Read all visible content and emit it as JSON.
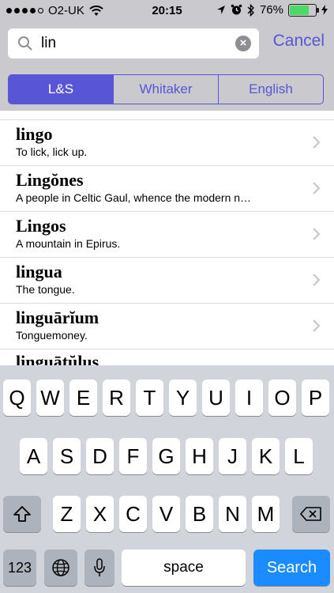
{
  "status_bar": {
    "carrier": "O2-UK",
    "time": "20:15",
    "battery": "76%",
    "battery_level": 0.76,
    "signal_bars_filled": 4,
    "signal_bars_total": 5
  },
  "search": {
    "value": "lin",
    "cancel_label": "Cancel"
  },
  "segments": [
    {
      "label": "L&S",
      "active": true
    },
    {
      "label": "Whitaker",
      "active": false
    },
    {
      "label": "English",
      "active": false
    }
  ],
  "results": [
    {
      "headword": "lingo",
      "definition": "To lick, lick up."
    },
    {
      "headword": "Lingŏnes",
      "definition": "A people in Celtic Gaul, whence the modern n…"
    },
    {
      "headword": "Lingos",
      "definition": "A mountain in Epirus."
    },
    {
      "headword": "lingua",
      "definition": "The tongue."
    },
    {
      "headword": "linguārĭum",
      "definition": "Tonguemoney."
    }
  ],
  "partial_result": {
    "headword": "linguātŭlus"
  },
  "keyboard": {
    "row1": [
      "Q",
      "W",
      "E",
      "R",
      "T",
      "Y",
      "U",
      "I",
      "O",
      "P"
    ],
    "row2": [
      "A",
      "S",
      "D",
      "F",
      "G",
      "H",
      "J",
      "K",
      "L"
    ],
    "row3": [
      "Z",
      "X",
      "C",
      "V",
      "B",
      "N",
      "M"
    ],
    "numbers_label": "123",
    "space_label": "space",
    "search_label": "Search"
  },
  "colors": {
    "accent": "#5856d6",
    "search_key": "#1a8cff",
    "battery": "#4cd964"
  },
  "icons": {
    "wifi": "wifi-icon",
    "location": "location-arrow-icon",
    "alarm": "alarm-icon",
    "bluetooth": "bluetooth-icon",
    "charging": "charging-bolt-icon",
    "search": "magnifier-icon",
    "clear": "clear-x-icon",
    "chevron": "chevron-right-icon",
    "shift": "shift-arrow-icon",
    "delete": "backspace-icon",
    "globe": "globe-icon",
    "mic": "microphone-icon"
  }
}
